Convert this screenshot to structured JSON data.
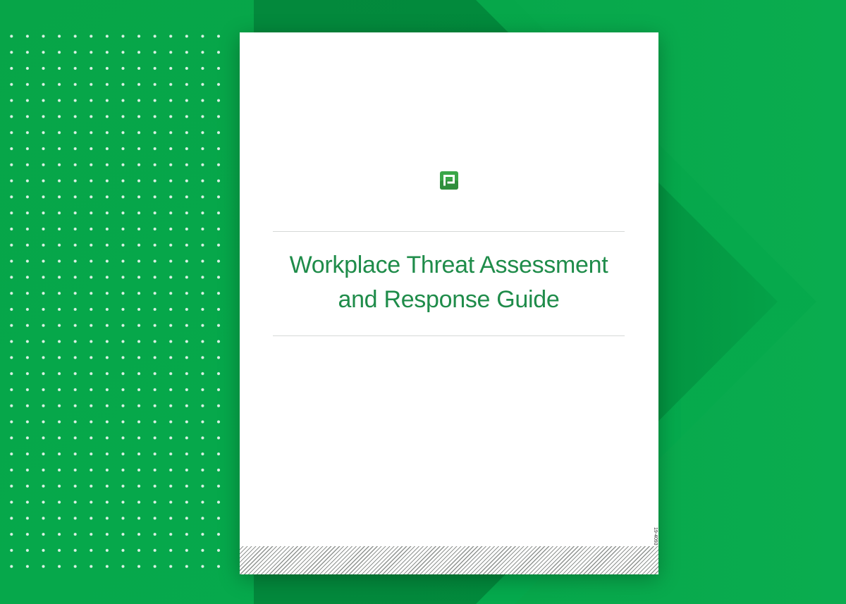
{
  "page": {
    "colors": {
      "background": "#07a64a",
      "background_dark": "#05803a",
      "title": "#1f8c4a",
      "logo": "#3aa648"
    }
  },
  "document": {
    "logo_icon": "paycom-logo-icon",
    "title_line1": "Workplace Threat Assessment",
    "title_line2": "and Response Guide",
    "code": "19-4093"
  }
}
